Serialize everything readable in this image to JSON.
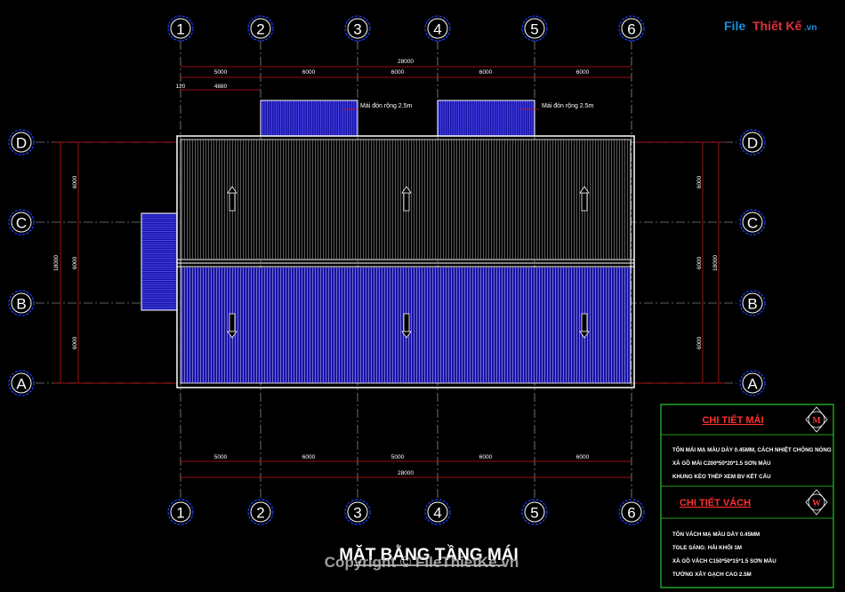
{
  "logo": {
    "part1": "File",
    "part2": "Thiết Kế",
    "part3": ".vn"
  },
  "grid_columns": [
    "1",
    "2",
    "3",
    "4",
    "5",
    "6"
  ],
  "grid_rows": [
    "D",
    "C",
    "B",
    "A"
  ],
  "dims_top": [
    "5000",
    "6000",
    "6000",
    "6000",
    "6000"
  ],
  "dims_top_total": "28000",
  "dims_offset": [
    "120",
    "4880"
  ],
  "dims_bottom": [
    "5000",
    "6000",
    "5000",
    "6000",
    "6000"
  ],
  "dims_bottom_total": "28000",
  "dims_side": [
    "6000",
    "6000",
    "6000"
  ],
  "dims_side_total": "18000",
  "notes": {
    "canopy": "Mái đón rộng 2.5m"
  },
  "legend": {
    "roof": {
      "title": "CHI TIẾT MÁI",
      "tag": "M",
      "lines": [
        "TÔN MÁI MẠ MÀU DÀY 0.45MM, CÁCH NHIỆT CHỐNG NÓNG",
        "XÀ GỒ MÁI C200*50*20*1.5 SƠN MÀU",
        "KHUNG KÈO THÉP XEM BV KẾT CẤU"
      ]
    },
    "wall": {
      "title": "CHI TIẾT VÁCH",
      "tag": "W",
      "lines": [
        "TÔN VÁCH MẠ MÀU DÀY 0.45MM",
        "TOLE SÁNG: HẢI KHỐI 1M",
        "XÀ GỒ VÁCH C150*50*15*1.5 SƠN MÀU",
        "TƯỜNG XÂY GẠCH CAO 2.5M"
      ]
    }
  },
  "title": "MẶT BẰNG TẦNG MÁI",
  "copyright": "Copyright © FileThietKe.vn",
  "colors": {
    "roof_fill": "#1a13a8",
    "bubble_stroke": "#1a3cff",
    "dim_red": "#c81414",
    "legend_frame": "#1fa01f",
    "accent_red": "#ff3030"
  }
}
